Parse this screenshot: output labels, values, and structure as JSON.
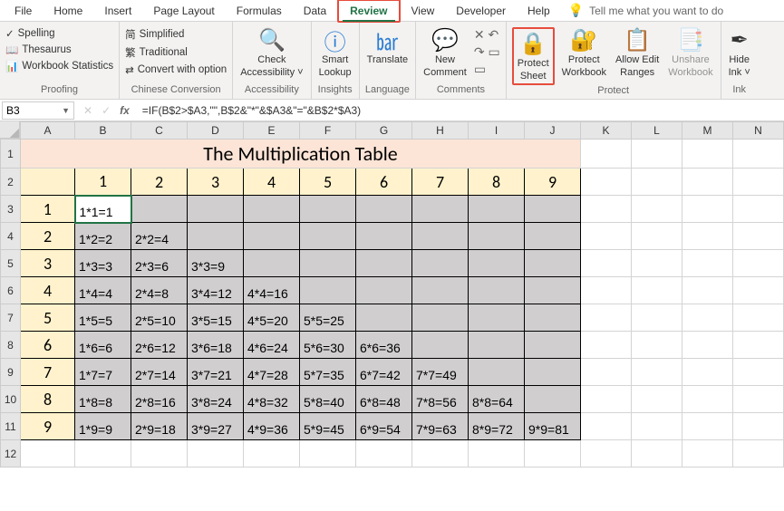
{
  "ribbon": {
    "tabs": [
      "File",
      "Home",
      "Insert",
      "Page Layout",
      "Formulas",
      "Data",
      "Review",
      "View",
      "Developer",
      "Help"
    ],
    "active_tab": "Review",
    "tellme": "Tell me what you want to do",
    "groups": {
      "proofing": {
        "label": "Proofing",
        "spelling": "Spelling",
        "thesaurus": "Thesaurus",
        "workbook_stats": "Workbook Statistics"
      },
      "chinese": {
        "label": "Chinese Conversion",
        "simplified": "Simplified",
        "traditional": "Traditional",
        "convert_opt": "Convert with option"
      },
      "accessibility": {
        "label": "Accessibility",
        "check": "Check",
        "check2": "Accessibility ˅"
      },
      "insights": {
        "label": "Insights",
        "smart": "Smart",
        "lookup": "Lookup"
      },
      "language": {
        "label": "Language",
        "translate": "Translate"
      },
      "comments": {
        "label": "Comments",
        "new": "New",
        "comment": "Comment"
      },
      "protect": {
        "label": "Protect",
        "protect_sheet1": "Protect",
        "protect_sheet2": "Sheet",
        "protect_wb1": "Protect",
        "protect_wb2": "Workbook",
        "allow1": "Allow Edit",
        "allow2": "Ranges",
        "unshare1": "Unshare",
        "unshare2": "Workbook"
      },
      "ink": {
        "label": "Ink",
        "hide1": "Hide",
        "hide2": "Ink ˅"
      }
    }
  },
  "formula_bar": {
    "name_box": "B3",
    "formula": "=IF(B$2>$A3,\"\",B$2&\"*\"&$A3&\"=\"&B$2*$A3)"
  },
  "sheet": {
    "col_letters": [
      "A",
      "B",
      "C",
      "D",
      "E",
      "F",
      "G",
      "H",
      "I",
      "J",
      "K",
      "L",
      "M",
      "N"
    ],
    "title": "The Multiplication Table",
    "col_nums": [
      "1",
      "2",
      "3",
      "4",
      "5",
      "6",
      "7",
      "8",
      "9"
    ],
    "rows": [
      {
        "n": "1",
        "v": [
          "1*1=1",
          "",
          "",
          "",
          "",
          "",
          "",
          "",
          ""
        ]
      },
      {
        "n": "2",
        "v": [
          "1*2=2",
          "2*2=4",
          "",
          "",
          "",
          "",
          "",
          "",
          ""
        ]
      },
      {
        "n": "3",
        "v": [
          "1*3=3",
          "2*3=6",
          "3*3=9",
          "",
          "",
          "",
          "",
          "",
          ""
        ]
      },
      {
        "n": "4",
        "v": [
          "1*4=4",
          "2*4=8",
          "3*4=12",
          "4*4=16",
          "",
          "",
          "",
          "",
          ""
        ]
      },
      {
        "n": "5",
        "v": [
          "1*5=5",
          "2*5=10",
          "3*5=15",
          "4*5=20",
          "5*5=25",
          "",
          "",
          "",
          ""
        ]
      },
      {
        "n": "6",
        "v": [
          "1*6=6",
          "2*6=12",
          "3*6=18",
          "4*6=24",
          "5*6=30",
          "6*6=36",
          "",
          "",
          ""
        ]
      },
      {
        "n": "7",
        "v": [
          "1*7=7",
          "2*7=14",
          "3*7=21",
          "4*7=28",
          "5*7=35",
          "6*7=42",
          "7*7=49",
          "",
          ""
        ]
      },
      {
        "n": "8",
        "v": [
          "1*8=8",
          "2*8=16",
          "3*8=24",
          "4*8=32",
          "5*8=40",
          "6*8=48",
          "7*8=56",
          "8*8=64",
          ""
        ]
      },
      {
        "n": "9",
        "v": [
          "1*9=9",
          "2*9=18",
          "3*9=27",
          "4*9=36",
          "5*9=45",
          "6*9=54",
          "7*9=63",
          "8*9=72",
          "9*9=81"
        ]
      }
    ]
  }
}
